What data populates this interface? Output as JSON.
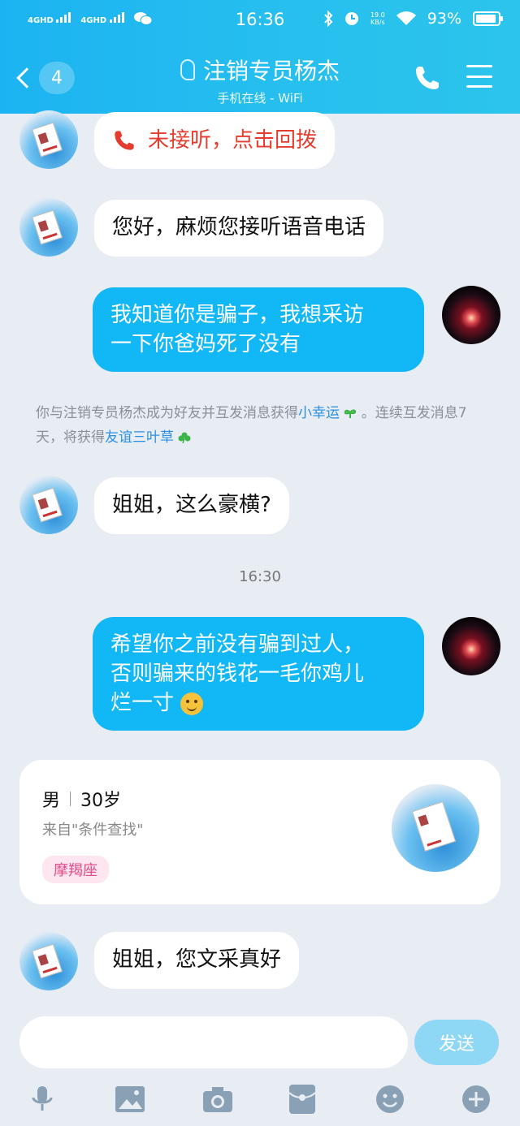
{
  "status_bar": {
    "net1": "4GHD",
    "net2": "4GHD",
    "time": "16:36",
    "speed_value": "19.0",
    "speed_unit": "KB/s",
    "battery": "93%",
    "battery_level": 0.93
  },
  "header": {
    "unread_count": "4",
    "title": "注销专员杨杰",
    "subtitle": "手机在线 - WiFi",
    "bg_color": "#1cb3f2"
  },
  "messages": [
    {
      "side": "in",
      "text": "未接听，点击回拨",
      "type": "missed_call"
    },
    {
      "side": "in",
      "text": "您好，麻烦您接听语音电话"
    },
    {
      "side": "out",
      "line1": "我知道你是骗子，我想采访",
      "line2": "一下你爸妈死了没有"
    },
    {
      "side": "in",
      "text": "姐姐，这么豪横?"
    },
    {
      "side": "out",
      "line1": "希望你之前没有骗到过人，",
      "line2": "否则骗来的钱花一毛你鸡儿",
      "line3": "烂一寸"
    },
    {
      "side": "in",
      "text": "姐姐，您文采真好"
    }
  ],
  "system_note": {
    "part1": "你与注销专员杨杰成为好友并互发消息获得",
    "link1": "小幸运",
    "part2": " 。连续互发消息7天，将获得",
    "link2": "友谊三叶草"
  },
  "timestamp": "16:30",
  "profile_card": {
    "gender": "男",
    "age": "30岁",
    "source": "来自\"条件查找\"",
    "zodiac": "摩羯座"
  },
  "input": {
    "send_label": "发送"
  },
  "toolbar": [
    "mic-icon",
    "image-icon",
    "camera-icon",
    "red-packet-icon",
    "emoji-icon",
    "plus-icon"
  ],
  "colors": {
    "outgoing_bubble": "#12b7f5",
    "missed_call": "#e43d2f",
    "link": "#2a8fe0"
  }
}
